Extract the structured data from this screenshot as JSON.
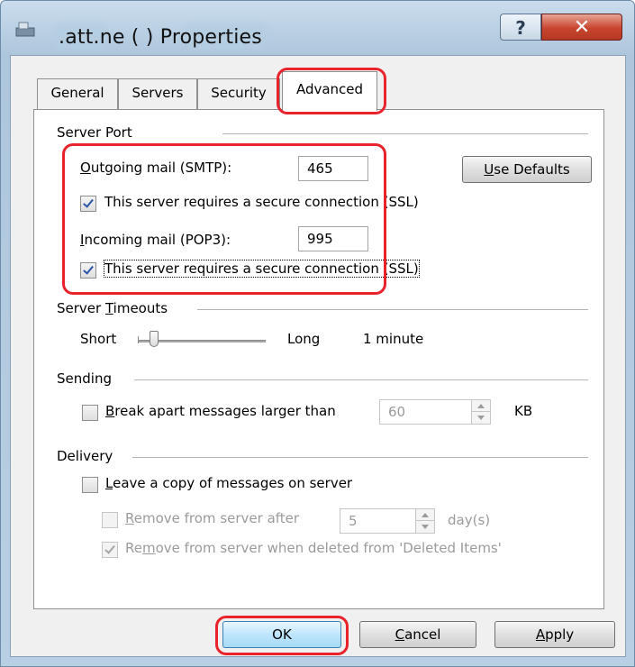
{
  "window": {
    "title": ".att.ne (   ) Properties",
    "title_icon": "mail-account-icon",
    "help_label": "?",
    "close_label": "✕"
  },
  "tabs": [
    {
      "label": "General",
      "selected": false
    },
    {
      "label": "Servers",
      "selected": false
    },
    {
      "label": "Security",
      "selected": false
    },
    {
      "label": "Advanced",
      "selected": true
    }
  ],
  "server_port": {
    "section_label": "Server Port",
    "outgoing_label_accel": "O",
    "outgoing_label_rest": "utgoing mail (SMTP):",
    "outgoing_value": "465",
    "outgoing_ssl_label": "This server requires a secure connection (SSL)",
    "outgoing_ssl_checked": true,
    "use_defaults_accel": "U",
    "use_defaults_rest": "se Defaults",
    "incoming_label_accel": "I",
    "incoming_label_rest": "ncoming mail (POP3):",
    "incoming_value": "995",
    "incoming_ssl_label": "This server requires a secure connection (SSL)",
    "incoming_ssl_checked": true
  },
  "server_timeouts": {
    "section_label_pre": "Server ",
    "section_label_accel": "T",
    "section_label_rest": "imeouts",
    "short_label": "Short",
    "long_label": "Long",
    "value_label": "1 minute",
    "slider_level": 0.1
  },
  "sending": {
    "section_label": "Sending",
    "break_accel": "B",
    "break_rest": "reak apart messages larger than",
    "break_checked": false,
    "size_value": "60",
    "size_unit": "KB"
  },
  "delivery": {
    "section_label": "Delivery",
    "leave_copy_accel": "L",
    "leave_copy_rest": "eave a copy of messages on server",
    "leave_copy_checked": false,
    "remove_after_accel": "R",
    "remove_after_rest": "emove from server after",
    "remove_after_checked": false,
    "days_value": "5",
    "days_unit": "day(s)",
    "remove_deleted_pre": "Re",
    "remove_deleted_accel": "m",
    "remove_deleted_rest": "ove from server when deleted from 'Deleted Items'",
    "remove_deleted_checked": true
  },
  "buttons": {
    "ok": "OK",
    "cancel_accel": "C",
    "cancel_rest": "ancel",
    "apply_accel": "A",
    "apply_rest": "pply"
  },
  "colors": {
    "highlight": "#e8232b",
    "check": "#2b55a7"
  }
}
